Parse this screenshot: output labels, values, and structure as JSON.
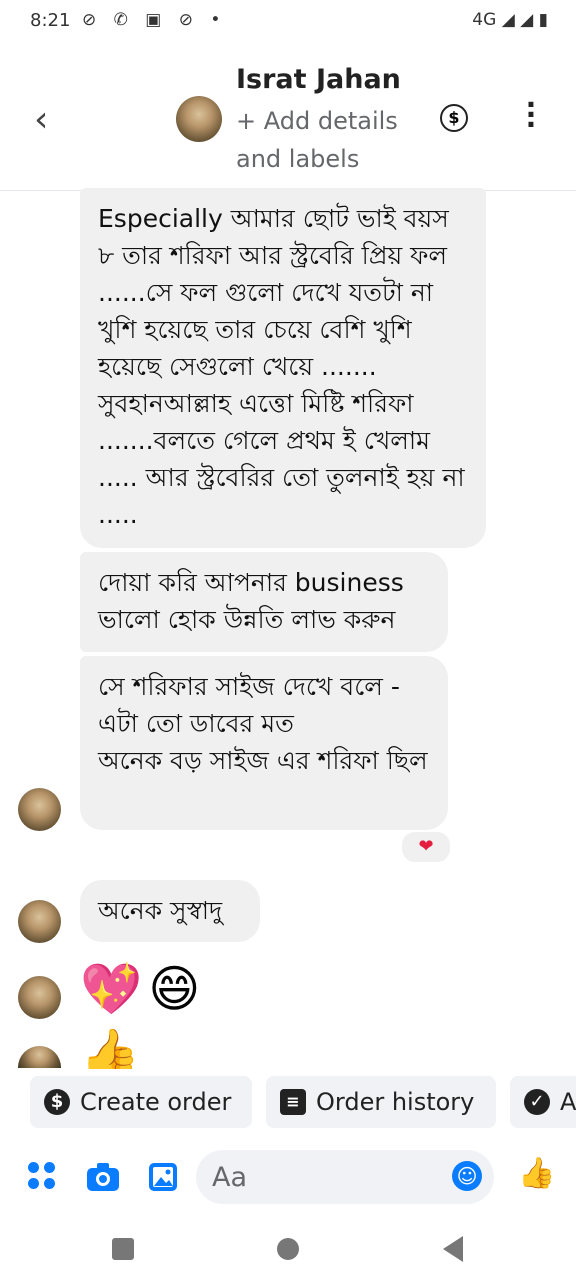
{
  "status_bar": {
    "time": "8:21",
    "right": "4G ◢ ◢ ▮"
  },
  "header": {
    "contact_name": "Israt Jahan",
    "subtitle": "+ Add details and labels",
    "dollar_symbol": "$"
  },
  "messages": [
    {
      "text": "Especially আমার ছোট ভাই বয়স ৮ তার শরিফা  আর স্ট্রবেরি প্রিয় ফল ......সে ফল গুলো দেখে যতটা না খুশি হয়েছে তার চেয়ে বেশি খুশি হয়েছে সেগুলো খেয়ে ....... সুবহানআল্লাহ এত্তো মিষ্টি শরিফা .......বলতে গেলে প্রথম ই খেলাম ..... আর স্ট্রবেরির তো তুলনাই হয় না ....."
    },
    {
      "text": "দোয়া করি আপনার business ভালো হোক উন্নতি লাভ করুন"
    },
    {
      "text": "সে শরিফার সাইজ দেখে বলে - এটা তো ডাবের মত\nঅনেক বড় সাইজ এর শরিফা ছিল"
    },
    {
      "text": "অনেক সুস্বাদু"
    }
  ],
  "reaction": "❤",
  "emojis": [
    "💖",
    "😄"
  ],
  "chips": [
    {
      "label": "Create order",
      "icon": "dollar-icon"
    },
    {
      "label": "Order history",
      "icon": "receipt-icon"
    },
    {
      "label": "A",
      "icon": "check-circle-icon"
    }
  ],
  "composer": {
    "placeholder": "Aa"
  },
  "colors": {
    "accent": "#0a7cff",
    "bubble": "#f0f0f0"
  }
}
